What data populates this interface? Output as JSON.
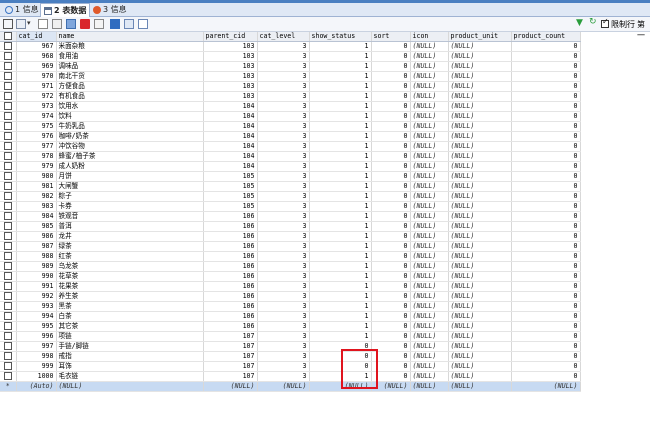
{
  "tabs": [
    {
      "label": "1 信息",
      "active": false
    },
    {
      "label": "2 表数据",
      "active": true
    },
    {
      "label": "3 信息",
      "active": false
    }
  ],
  "toolbar": {
    "filter_checkbox_label": "限制行",
    "page_label": "第一"
  },
  "columns": [
    "cat_id",
    "name",
    "parent_cid",
    "cat_level",
    "show_status",
    "sort",
    "icon",
    "product_unit",
    "product_count"
  ],
  "rows": [
    [
      "967",
      "米面杂粮",
      "103",
      "3",
      "1",
      "0",
      "(NULL)",
      "(NULL)",
      "0"
    ],
    [
      "968",
      "食用油",
      "103",
      "3",
      "1",
      "0",
      "(NULL)",
      "(NULL)",
      "0"
    ],
    [
      "969",
      "调味品",
      "103",
      "3",
      "1",
      "0",
      "(NULL)",
      "(NULL)",
      "0"
    ],
    [
      "970",
      "南北干货",
      "103",
      "3",
      "1",
      "0",
      "(NULL)",
      "(NULL)",
      "0"
    ],
    [
      "971",
      "方便食品",
      "103",
      "3",
      "1",
      "0",
      "(NULL)",
      "(NULL)",
      "0"
    ],
    [
      "972",
      "有机食品",
      "103",
      "3",
      "1",
      "0",
      "(NULL)",
      "(NULL)",
      "0"
    ],
    [
      "973",
      "饮用水",
      "104",
      "3",
      "1",
      "0",
      "(NULL)",
      "(NULL)",
      "0"
    ],
    [
      "974",
      "饮料",
      "104",
      "3",
      "1",
      "0",
      "(NULL)",
      "(NULL)",
      "0"
    ],
    [
      "975",
      "牛奶乳品",
      "104",
      "3",
      "1",
      "0",
      "(NULL)",
      "(NULL)",
      "0"
    ],
    [
      "976",
      "咖啡/奶茶",
      "104",
      "3",
      "1",
      "0",
      "(NULL)",
      "(NULL)",
      "0"
    ],
    [
      "977",
      "冲饮谷物",
      "104",
      "3",
      "1",
      "0",
      "(NULL)",
      "(NULL)",
      "0"
    ],
    [
      "978",
      "蜂蜜/柚子茶",
      "104",
      "3",
      "1",
      "0",
      "(NULL)",
      "(NULL)",
      "0"
    ],
    [
      "979",
      "成人奶粉",
      "104",
      "3",
      "1",
      "0",
      "(NULL)",
      "(NULL)",
      "0"
    ],
    [
      "980",
      "月饼",
      "105",
      "3",
      "1",
      "0",
      "(NULL)",
      "(NULL)",
      "0"
    ],
    [
      "981",
      "大闸蟹",
      "105",
      "3",
      "1",
      "0",
      "(NULL)",
      "(NULL)",
      "0"
    ],
    [
      "982",
      "粽子",
      "105",
      "3",
      "1",
      "0",
      "(NULL)",
      "(NULL)",
      "0"
    ],
    [
      "983",
      "卡券",
      "105",
      "3",
      "1",
      "0",
      "(NULL)",
      "(NULL)",
      "0"
    ],
    [
      "984",
      "铁观音",
      "106",
      "3",
      "1",
      "0",
      "(NULL)",
      "(NULL)",
      "0"
    ],
    [
      "985",
      "普洱",
      "106",
      "3",
      "1",
      "0",
      "(NULL)",
      "(NULL)",
      "0"
    ],
    [
      "986",
      "龙井",
      "106",
      "3",
      "1",
      "0",
      "(NULL)",
      "(NULL)",
      "0"
    ],
    [
      "987",
      "绿茶",
      "106",
      "3",
      "1",
      "0",
      "(NULL)",
      "(NULL)",
      "0"
    ],
    [
      "988",
      "红茶",
      "106",
      "3",
      "1",
      "0",
      "(NULL)",
      "(NULL)",
      "0"
    ],
    [
      "989",
      "乌龙茶",
      "106",
      "3",
      "1",
      "0",
      "(NULL)",
      "(NULL)",
      "0"
    ],
    [
      "990",
      "花草茶",
      "106",
      "3",
      "1",
      "0",
      "(NULL)",
      "(NULL)",
      "0"
    ],
    [
      "991",
      "花果茶",
      "106",
      "3",
      "1",
      "0",
      "(NULL)",
      "(NULL)",
      "0"
    ],
    [
      "992",
      "养生茶",
      "106",
      "3",
      "1",
      "0",
      "(NULL)",
      "(NULL)",
      "0"
    ],
    [
      "993",
      "黑茶",
      "106",
      "3",
      "1",
      "0",
      "(NULL)",
      "(NULL)",
      "0"
    ],
    [
      "994",
      "白茶",
      "106",
      "3",
      "1",
      "0",
      "(NULL)",
      "(NULL)",
      "0"
    ],
    [
      "995",
      "其它茶",
      "106",
      "3",
      "1",
      "0",
      "(NULL)",
      "(NULL)",
      "0"
    ],
    [
      "996",
      "项链",
      "107",
      "3",
      "1",
      "0",
      "(NULL)",
      "(NULL)",
      "0"
    ],
    [
      "997",
      "手链/脚链",
      "107",
      "3",
      "0",
      "0",
      "(NULL)",
      "(NULL)",
      "0"
    ],
    [
      "998",
      "戒指",
      "107",
      "3",
      "0",
      "0",
      "(NULL)",
      "(NULL)",
      "0"
    ],
    [
      "999",
      "耳饰",
      "107",
      "3",
      "0",
      "0",
      "(NULL)",
      "(NULL)",
      "0"
    ],
    [
      "1000",
      "毛衣链",
      "107",
      "3",
      "1",
      "0",
      "(NULL)",
      "(NULL)",
      "0"
    ]
  ],
  "new_row": [
    "(Auto)",
    "(NULL)",
    "(NULL)",
    "(NULL)",
    "(NULL)",
    "(NULL)",
    "(NULL)",
    "(NULL)",
    "(NULL)"
  ],
  "new_row_marker": "*",
  "colors": {
    "title_bar": "#4a7fc1",
    "highlight_box": "#e0141e",
    "new_row": "#c7daf2"
  }
}
